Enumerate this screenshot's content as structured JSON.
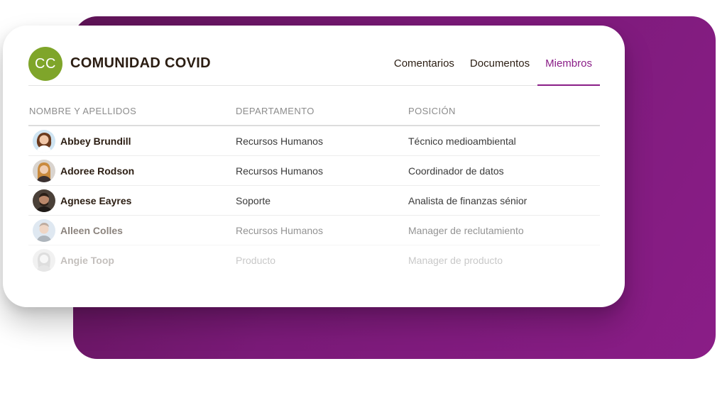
{
  "community": {
    "initials": "CC",
    "title": "COMUNIDAD COVID",
    "badge_color": "#7fa52a"
  },
  "tabs": [
    {
      "label": "Comentarios",
      "active": false
    },
    {
      "label": "Documentos",
      "active": false
    },
    {
      "label": "Miembros",
      "active": true
    }
  ],
  "accent_color": "#8a1d87",
  "table": {
    "columns": [
      "NOMBRE Y APELLIDOS",
      "DEPARTAMENTO",
      "POSICIÓN"
    ],
    "rows": [
      {
        "name": "Abbey Brundill",
        "department": "Recursos Humanos",
        "position": "Técnico medioambiental",
        "avatar": "avatar-icon"
      },
      {
        "name": "Adoree Rodson",
        "department": "Recursos Humanos",
        "position": "Coordinador de datos",
        "avatar": "avatar-icon"
      },
      {
        "name": "Agnese Eayres",
        "department": "Soporte",
        "position": "Analista de finanzas sénior",
        "avatar": "avatar-icon"
      },
      {
        "name": "Alleen Colles",
        "department": "Recursos Humanos",
        "position": "Manager de reclutamiento",
        "avatar": "avatar-icon"
      },
      {
        "name": "Angie Toop",
        "department": "Producto",
        "position": "Manager de producto",
        "avatar": "avatar-icon"
      }
    ]
  }
}
